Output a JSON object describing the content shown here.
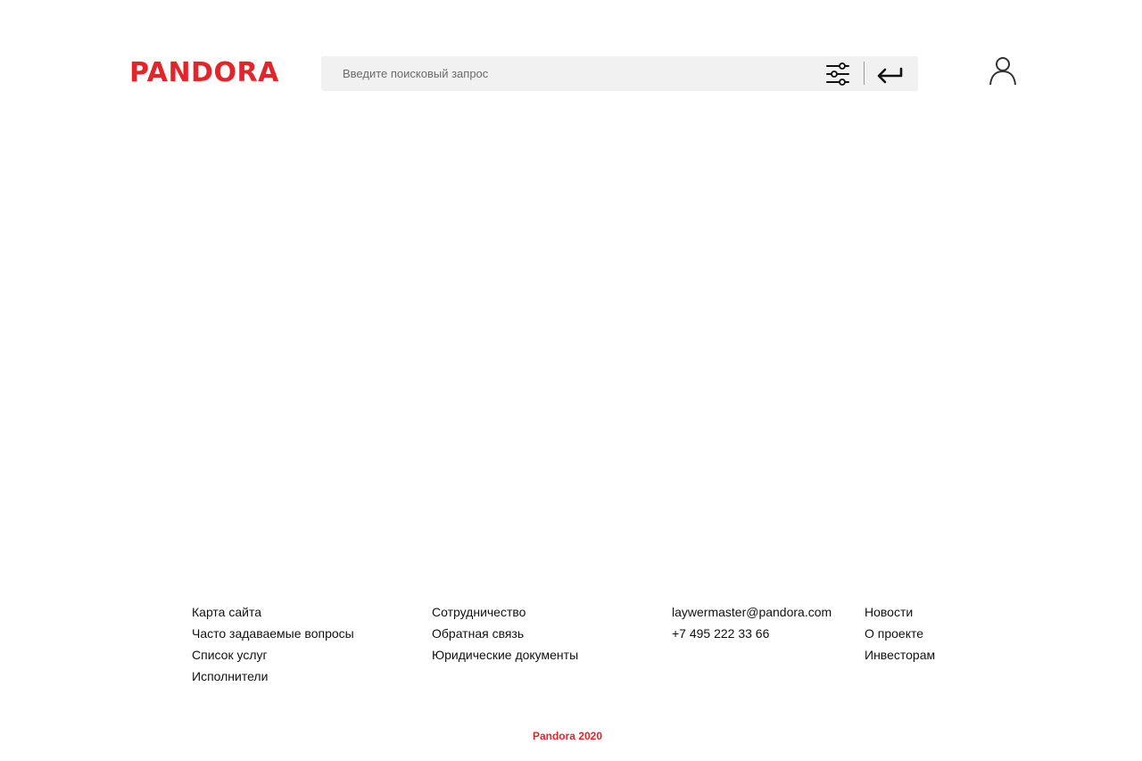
{
  "header": {
    "logo_text": "PANDORA",
    "search": {
      "placeholder": "Введите поисковый запрос",
      "value": ""
    },
    "icons": {
      "filter": "sliders-icon",
      "submit": "enter-arrow-icon",
      "user": "user-icon"
    }
  },
  "footer": {
    "columns": [
      {
        "items": [
          {
            "label": "Карта сайта"
          },
          {
            "label": "Часто задаваемые вопросы"
          },
          {
            "label": "Список услуг"
          },
          {
            "label": "Исполнители"
          }
        ]
      },
      {
        "items": [
          {
            "label": "Сотрудничество"
          },
          {
            "label": "Обратная связь"
          },
          {
            "label": "Юридические документы"
          }
        ]
      },
      {
        "items": [
          {
            "label": "laywermaster@pandora.com"
          },
          {
            "label": "+7 495 222 33 66"
          }
        ]
      },
      {
        "items": [
          {
            "label": "Новости"
          },
          {
            "label": "О проекте"
          },
          {
            "label": "Инвесторам"
          }
        ]
      }
    ],
    "copyright": "Pandora 2020"
  },
  "colors": {
    "brand": "#e3242b",
    "search_background": "#f1f1f1",
    "text": "#111111"
  }
}
